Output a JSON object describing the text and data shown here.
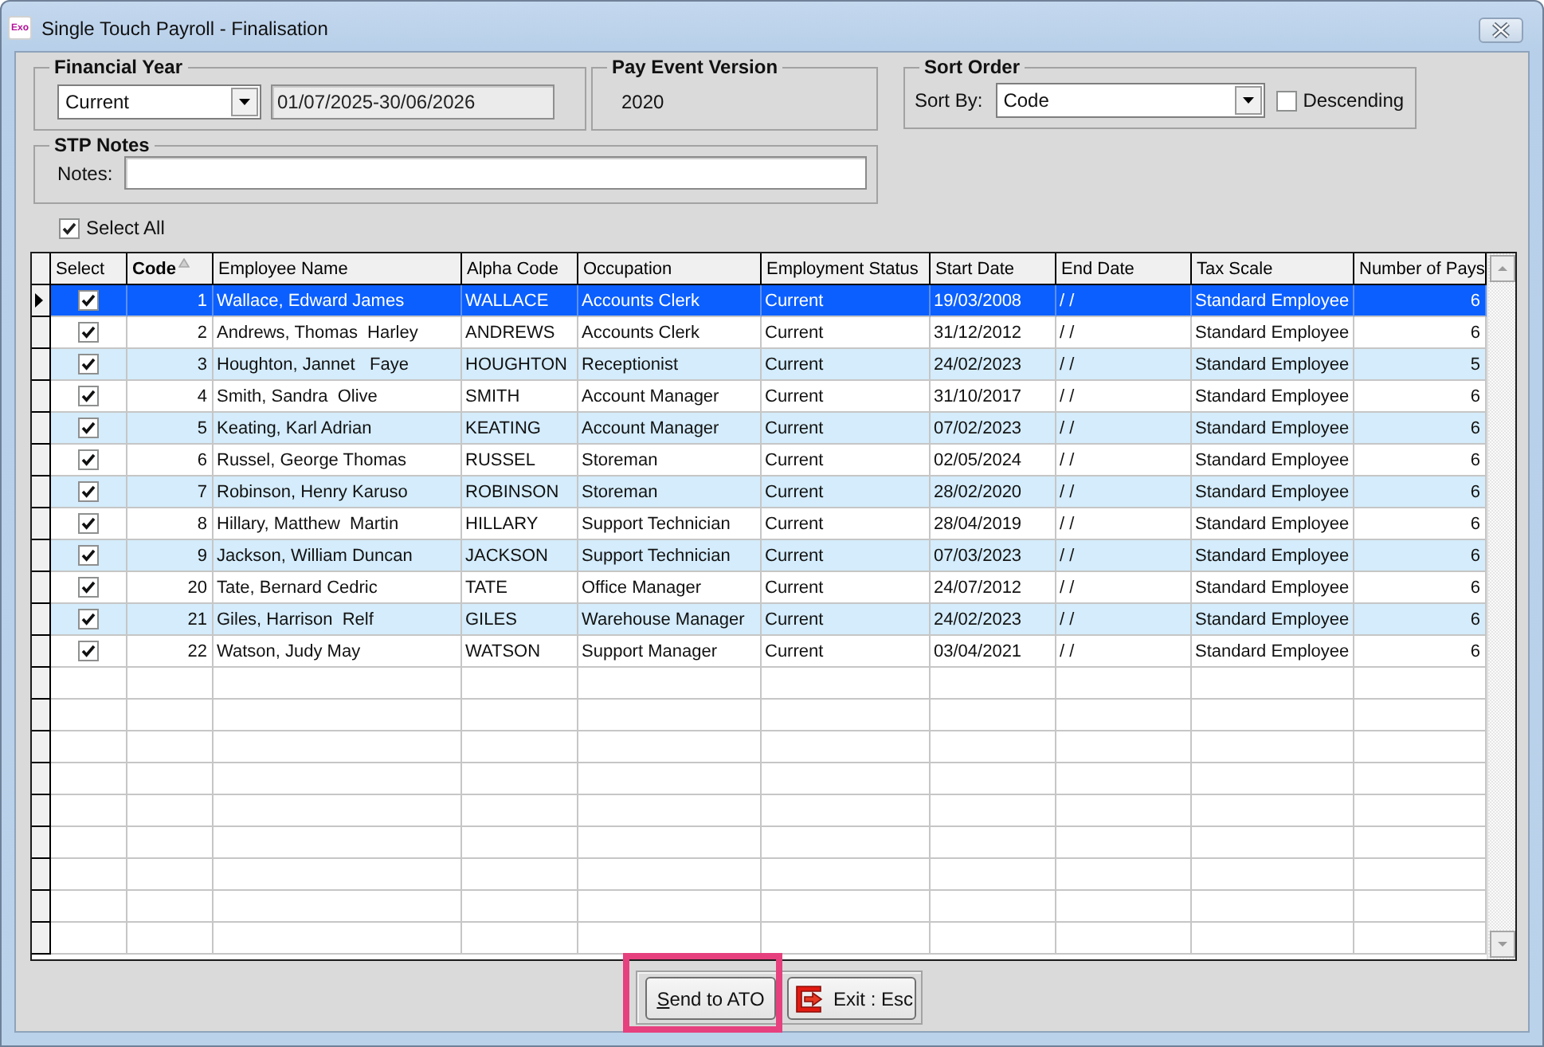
{
  "window": {
    "logo": "Exo",
    "title": "Single Touch Payroll - Finalisation"
  },
  "financial_year": {
    "title": "Financial Year",
    "year": "Current",
    "date_range": "01/07/2025-30/06/2026"
  },
  "pay_event_version": {
    "title": "Pay Event Version",
    "value": "2020"
  },
  "sort_order": {
    "title": "Sort Order",
    "sort_by_label": "Sort By:",
    "sort_by": "Code",
    "descending": {
      "label": "Descending",
      "checked": false
    }
  },
  "stp_notes": {
    "title": "STP Notes",
    "notes_label": "Notes:"
  },
  "select_all": {
    "label": "Select All",
    "checked": true
  },
  "table": {
    "columns": [
      {
        "label": "Select",
        "kind": "check",
        "sorted": false
      },
      {
        "label": "Code",
        "kind": "number",
        "sorted": true
      },
      {
        "label": "Employee Name",
        "kind": "text",
        "sorted": false
      },
      {
        "label": "Alpha Code",
        "kind": "text",
        "sorted": false
      },
      {
        "label": "Occupation",
        "kind": "text",
        "sorted": false
      },
      {
        "label": "Employment Status",
        "kind": "text",
        "sorted": false
      },
      {
        "label": "Start Date",
        "kind": "text",
        "sorted": false
      },
      {
        "label": "End Date",
        "kind": "text",
        "sorted": false
      },
      {
        "label": "Tax Scale",
        "kind": "text",
        "sorted": false
      },
      {
        "label": "Number of Pays",
        "kind": "number",
        "sorted": false
      }
    ],
    "rows": [
      {
        "selected": true,
        "checked": true,
        "cells": [
          "",
          "1",
          "Wallace, Edward James",
          "WALLACE",
          "Accounts Clerk",
          "Current",
          "19/03/2008",
          "/ /",
          "Standard Employee",
          "6"
        ]
      },
      {
        "selected": false,
        "checked": true,
        "cells": [
          "",
          "2",
          "Andrews, Thomas  Harley",
          "ANDREWS",
          "Accounts Clerk",
          "Current",
          "31/12/2012",
          "/ /",
          "Standard Employee",
          "6"
        ]
      },
      {
        "selected": false,
        "checked": true,
        "cells": [
          "",
          "3",
          "Houghton, Jannet   Faye",
          "HOUGHTON",
          "Receptionist",
          "Current",
          "24/02/2023",
          "/ /",
          "Standard Employee",
          "5"
        ]
      },
      {
        "selected": false,
        "checked": true,
        "cells": [
          "",
          "4",
          "Smith, Sandra  Olive",
          "SMITH",
          "Account Manager",
          "Current",
          "31/10/2017",
          "/ /",
          "Standard Employee",
          "6"
        ]
      },
      {
        "selected": false,
        "checked": true,
        "cells": [
          "",
          "5",
          "Keating, Karl Adrian",
          "KEATING",
          "Account Manager",
          "Current",
          "07/02/2023",
          "/ /",
          "Standard Employee",
          "6"
        ]
      },
      {
        "selected": false,
        "checked": true,
        "cells": [
          "",
          "6",
          "Russel, George Thomas",
          "RUSSEL",
          "Storeman",
          "Current",
          "02/05/2024",
          "/ /",
          "Standard Employee",
          "6"
        ]
      },
      {
        "selected": false,
        "checked": true,
        "cells": [
          "",
          "7",
          "Robinson, Henry Karuso",
          "ROBINSON",
          "Storeman",
          "Current",
          "28/02/2020",
          "/ /",
          "Standard Employee",
          "6"
        ]
      },
      {
        "selected": false,
        "checked": true,
        "cells": [
          "",
          "8",
          "Hillary, Matthew  Martin",
          "HILLARY",
          "Support Technician",
          "Current",
          "28/04/2019",
          "/ /",
          "Standard Employee",
          "6"
        ]
      },
      {
        "selected": false,
        "checked": true,
        "cells": [
          "",
          "9",
          "Jackson, William Duncan",
          "JACKSON",
          "Support Technician",
          "Current",
          "07/03/2023",
          "/ /",
          "Standard Employee",
          "6"
        ]
      },
      {
        "selected": false,
        "checked": true,
        "cells": [
          "",
          "20",
          "Tate, Bernard Cedric",
          "TATE",
          "Office Manager",
          "Current",
          "24/07/2012",
          "/ /",
          "Standard Employee",
          "6"
        ]
      },
      {
        "selected": false,
        "checked": true,
        "cells": [
          "",
          "21",
          "Giles, Harrison  Relf",
          "GILES",
          "Warehouse Manager",
          "Current",
          "24/02/2023",
          "/ /",
          "Standard Employee",
          "6"
        ]
      },
      {
        "selected": false,
        "checked": true,
        "cells": [
          "",
          "22",
          "Watson, Judy May",
          "WATSON",
          "Support Manager",
          "Current",
          "03/04/2021",
          "/ /",
          "Standard Employee",
          "6"
        ]
      }
    ]
  },
  "buttons": [
    {
      "label": "Send to ATO",
      "kind": "send",
      "underline_first_letter": true,
      "highlighted": true
    },
    {
      "label": "Exit : Esc",
      "kind": "exit",
      "underline_first_letter": false,
      "highlighted": false
    }
  ]
}
